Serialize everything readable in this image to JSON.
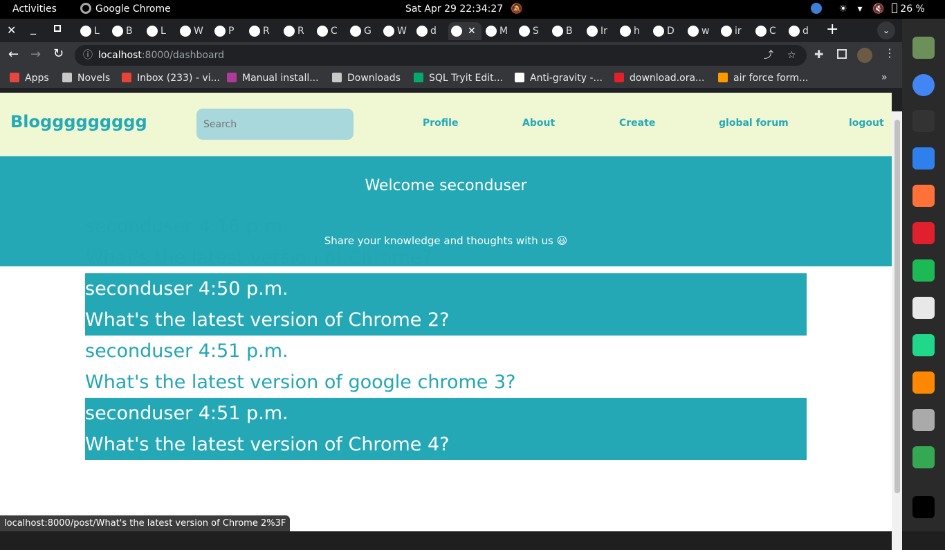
{
  "topbar": {
    "activities": "Activities",
    "app_name": "Google Chrome",
    "datetime": "Sat Apr 29  22:34:27",
    "battery": "26 %"
  },
  "tabs": [
    {
      "label": "L"
    },
    {
      "label": "B"
    },
    {
      "label": "L"
    },
    {
      "label": "W"
    },
    {
      "label": "P"
    },
    {
      "label": "R"
    },
    {
      "label": "R"
    },
    {
      "label": "C"
    },
    {
      "label": "G"
    },
    {
      "label": "W"
    },
    {
      "label": "d"
    },
    {
      "label": "",
      "active": true
    },
    {
      "label": "M"
    },
    {
      "label": "S"
    },
    {
      "label": "B"
    },
    {
      "label": "Ir"
    },
    {
      "label": "h"
    },
    {
      "label": "D"
    },
    {
      "label": "w"
    },
    {
      "label": "ir"
    },
    {
      "label": "C"
    },
    {
      "label": "d"
    }
  ],
  "toolbar": {
    "url_host": "localhost",
    "url_path": ":8000/dashboard"
  },
  "bookmarks": [
    {
      "label": "Apps",
      "color": "#e8453c"
    },
    {
      "label": "Novels",
      "color": "#c8c8c8"
    },
    {
      "label": "Inbox (233) - vi...",
      "color": "#ea4335"
    },
    {
      "label": "Manual install...",
      "color": "#b0399c"
    },
    {
      "label": "Downloads",
      "color": "#c8c8c8"
    },
    {
      "label": "SQL Tryit Edit...",
      "color": "#04aa6d"
    },
    {
      "label": "Anti-gravity -...",
      "color": "#ffffff"
    },
    {
      "label": "download.ora...",
      "color": "#e3202c"
    },
    {
      "label": "air force form...",
      "color": "#ff9900"
    }
  ],
  "site": {
    "brand": "Bloggggggggg",
    "search_placeholder": "Search",
    "nav": {
      "profile": "Profile",
      "about": "About",
      "create": "Create",
      "forum": "global forum",
      "logout": "logout"
    },
    "welcome": "Welcome seconduser",
    "tagline": "Share your knowledge and thoughts with us 😃"
  },
  "posts": [
    {
      "meta": "seconduser 4:16 p.m.",
      "title": "What's the latest version of Chrome?"
    },
    {
      "meta": "seconduser 4:50 p.m.",
      "title": "What's the latest version of Chrome 2?"
    },
    {
      "meta": "seconduser 4:51 p.m.",
      "title": "What's the latest version of google chrome 3?"
    },
    {
      "meta": "seconduser 4:51 p.m.",
      "title": "What's the latest version of Chrome 4?"
    }
  ],
  "status_url": "localhost:8000/post/What's the latest version of Chrome 2%3F",
  "colors": {
    "accent": "#24a8b6",
    "navbar_bg": "#eff8d2",
    "search_bg": "#a8d7dc"
  },
  "dock": [
    "files-icon",
    "chrome-icon",
    "terminal-icon",
    "vscode-icon",
    "firefox-icon",
    "opera-icon",
    "spotify-icon",
    "sudoku-icon",
    "pycharm-icon",
    "vlc-icon",
    "database-icon",
    "drive-icon",
    "app-grid-icon"
  ]
}
